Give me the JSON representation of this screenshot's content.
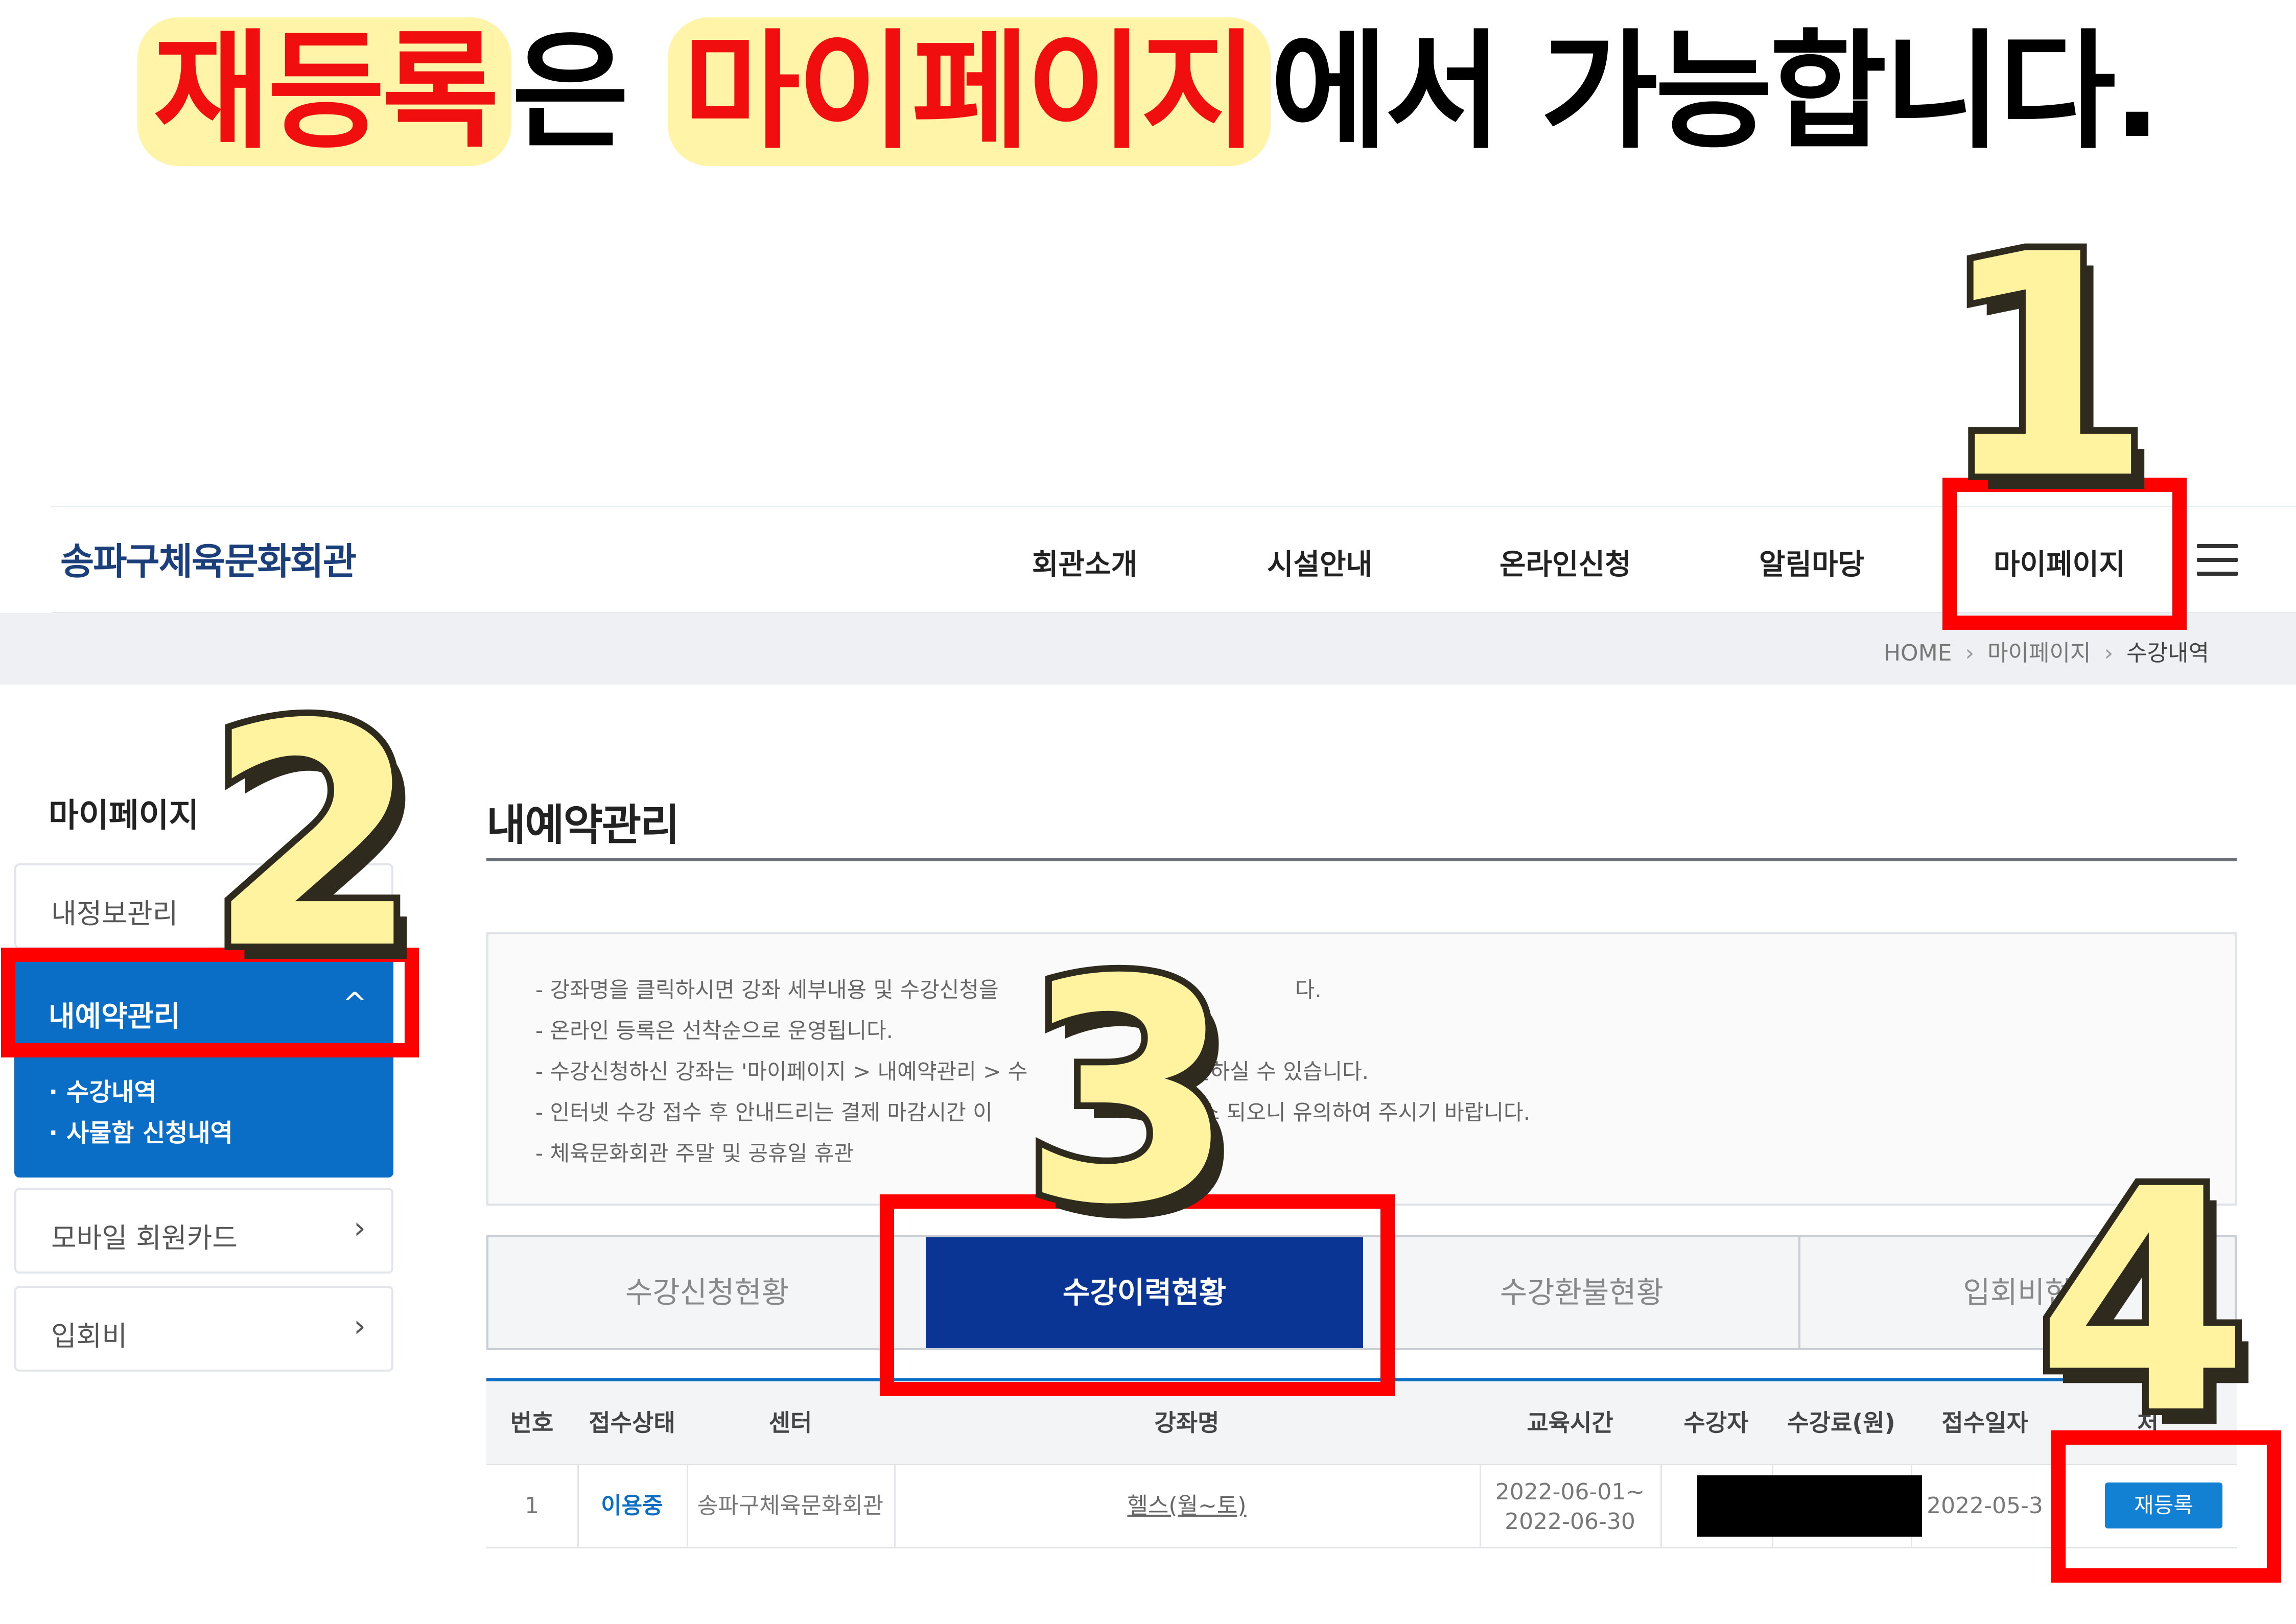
{
  "headline": {
    "part1": "재등록",
    "part2": "은 ",
    "part3": "마이페이지",
    "part4": "에서 가능합니다."
  },
  "steps": [
    "1",
    "2",
    "3",
    "4"
  ],
  "header": {
    "logo": "송파구체육문화회관",
    "nav": [
      "회관소개",
      "시설안내",
      "온라인신청",
      "알림마당",
      "마이페이지"
    ],
    "menu_icon": "hamburger-icon"
  },
  "breadcrumb": [
    "HOME",
    "마이페이지",
    "수강내역"
  ],
  "breadcrumb_sep": "›",
  "sidebar": {
    "title": "마이페이지",
    "items": [
      {
        "label": "내정보관리"
      },
      {
        "label": "내예약관리",
        "caret": "^"
      },
      {
        "label": "모바일 회원카드",
        "arrow": "›"
      },
      {
        "label": "입회비",
        "arrow": "›"
      }
    ],
    "sub_items": [
      "수강내역",
      "사물함 신청내역"
    ]
  },
  "main": {
    "title": "내예약관리",
    "notices": [
      "- 강좌명을 클릭하시면 강좌 세부내용 및 수강신청을",
      "- 온라인 등록은 선착순으로 운영됩니다.",
      "- 수강신청하신 강좌는 '마이페이지 > 내예약관리 > 수",
      "- 인터넷 수강 접수 후 안내드리는 결제 마감시간 이",
      "- 체육문화회관 주말 및 공휴일 휴관"
    ],
    "notices_tail": [
      "다.",
      "확인하실 수 있습니다.",
      "자동취소 되오니 유의하여 주시기 바랍니다."
    ],
    "tabs": [
      "수강신청현황",
      "수강이력현황",
      "수강환불현황",
      "입회비현"
    ]
  },
  "table": {
    "headers": [
      "번호",
      "접수상태",
      "센터",
      "강좌명",
      "교육시간",
      "수강자",
      "수강료(원)",
      "접수일자",
      "처"
    ],
    "row": {
      "no": "1",
      "status": "이용중",
      "center": "송파구체육문화회관",
      "course": "헬스(월~토)",
      "period_start": "2022-06-01~",
      "period_end": "2022-06-30",
      "fee": "",
      "date": "2022-05-3",
      "action": "재등록"
    }
  }
}
